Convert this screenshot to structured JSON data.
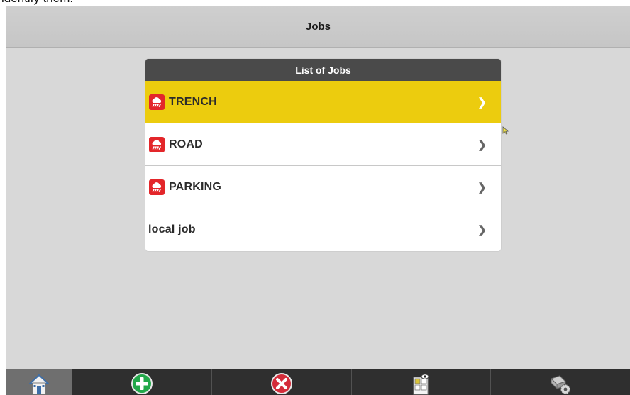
{
  "caption": {
    "text": "identify them."
  },
  "header": {
    "title": "Jobs"
  },
  "jobs_panel": {
    "title": "List of Jobs",
    "items": [
      {
        "label": "TRENCH",
        "has_cloud_icon": true,
        "selected": true,
        "arrow": "❯"
      },
      {
        "label": "ROAD",
        "has_cloud_icon": true,
        "selected": false,
        "arrow": "❯"
      },
      {
        "label": "PARKING",
        "has_cloud_icon": true,
        "selected": false,
        "arrow": "❯"
      },
      {
        "label": "local job",
        "has_cloud_icon": false,
        "selected": false,
        "arrow": "❯"
      }
    ]
  },
  "toolbar": {
    "buttons": [
      {
        "icon": "home-icon",
        "active": true
      },
      {
        "icon": "add-icon"
      },
      {
        "icon": "delete-icon"
      },
      {
        "icon": "job-info-icon"
      },
      {
        "icon": "machine-settings-icon"
      }
    ]
  },
  "colors": {
    "selected_row": "#eccc0e",
    "cloud_icon_bg": "#e3262a",
    "add_icon": "#22a84a",
    "delete_icon": "#d42c3a",
    "toolbar_bg": "#2f2f2f"
  }
}
